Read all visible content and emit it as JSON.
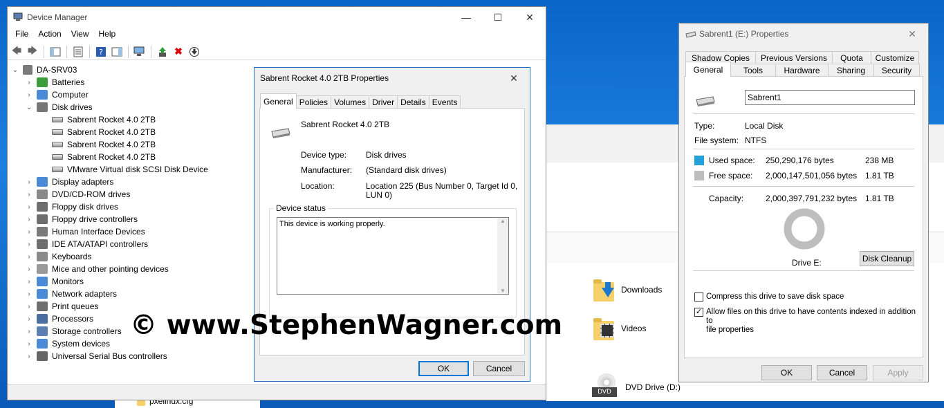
{
  "explorer": {
    "items": [
      {
        "label": "Downloads"
      },
      {
        "label": "Videos"
      },
      {
        "label": "DVD Drive (D:)"
      }
    ],
    "partial_file": "pxelinux.cfg"
  },
  "devmgr": {
    "title": "Device Manager",
    "menu": [
      "File",
      "Action",
      "View",
      "Help"
    ],
    "tree": {
      "root": "DA-SRV03",
      "categories": [
        {
          "label": "Batteries",
          "expanded": false
        },
        {
          "label": "Computer",
          "expanded": false
        },
        {
          "label": "Disk drives",
          "expanded": true,
          "children": [
            "Sabrent Rocket 4.0 2TB",
            "Sabrent Rocket 4.0 2TB",
            "Sabrent Rocket 4.0 2TB",
            "Sabrent Rocket 4.0 2TB",
            "VMware Virtual disk SCSI Disk Device"
          ]
        },
        {
          "label": "Display adapters",
          "expanded": false
        },
        {
          "label": "DVD/CD-ROM drives",
          "expanded": false
        },
        {
          "label": "Floppy disk drives",
          "expanded": false
        },
        {
          "label": "Floppy drive controllers",
          "expanded": false
        },
        {
          "label": "Human Interface Devices",
          "expanded": false
        },
        {
          "label": "IDE ATA/ATAPI controllers",
          "expanded": false
        },
        {
          "label": "Keyboards",
          "expanded": false
        },
        {
          "label": "Mice and other pointing devices",
          "expanded": false
        },
        {
          "label": "Monitors",
          "expanded": false
        },
        {
          "label": "Network adapters",
          "expanded": false
        },
        {
          "label": "Print queues",
          "expanded": false
        },
        {
          "label": "Processors",
          "expanded": false
        },
        {
          "label": "Storage controllers",
          "expanded": false
        },
        {
          "label": "System devices",
          "expanded": false
        },
        {
          "label": "Universal Serial Bus controllers",
          "expanded": false
        }
      ]
    }
  },
  "device_props": {
    "title": "Sabrent Rocket 4.0 2TB Properties",
    "tabs": [
      "General",
      "Policies",
      "Volumes",
      "Driver",
      "Details",
      "Events"
    ],
    "active_tab": "General",
    "device_name": "Sabrent Rocket 4.0 2TB",
    "device_type_label": "Device type:",
    "device_type": "Disk drives",
    "manufacturer_label": "Manufacturer:",
    "manufacturer": "(Standard disk drives)",
    "location_label": "Location:",
    "location_line1": "Location 225 (Bus Number 0, Target Id 0,",
    "location_line2": "LUN 0)",
    "status_group": "Device status",
    "status_text": "This device is working properly.",
    "ok": "OK",
    "cancel": "Cancel"
  },
  "drive_props": {
    "title": "Sabrent1 (E:) Properties",
    "tabs_row1": [
      "Shadow Copies",
      "Previous Versions",
      "Quota",
      "Customize"
    ],
    "tabs_row2": [
      "General",
      "Tools",
      "Hardware",
      "Sharing",
      "Security"
    ],
    "active_tab": "General",
    "volume_name": "Sabrent1",
    "type_label": "Type:",
    "type": "Local Disk",
    "fs_label": "File system:",
    "fs": "NTFS",
    "used_label": "Used space:",
    "used_bytes": "250,290,176 bytes",
    "used_h": "238 MB",
    "free_label": "Free space:",
    "free_bytes": "2,000,147,501,056 bytes",
    "free_h": "1.81 TB",
    "cap_label": "Capacity:",
    "cap_bytes": "2,000,397,791,232 bytes",
    "cap_h": "1.81 TB",
    "drive_label": "Drive E:",
    "cleanup": "Disk Cleanup",
    "compress": "Compress this drive to save disk space",
    "index_line1": "Allow files on this drive to have contents indexed in addition to",
    "index_line2": "file properties",
    "ok": "OK",
    "cancel": "Cancel",
    "apply": "Apply",
    "used_color": "#26a0da",
    "free_color": "#bebebe"
  },
  "watermark": "© www.StephenWagner.com"
}
